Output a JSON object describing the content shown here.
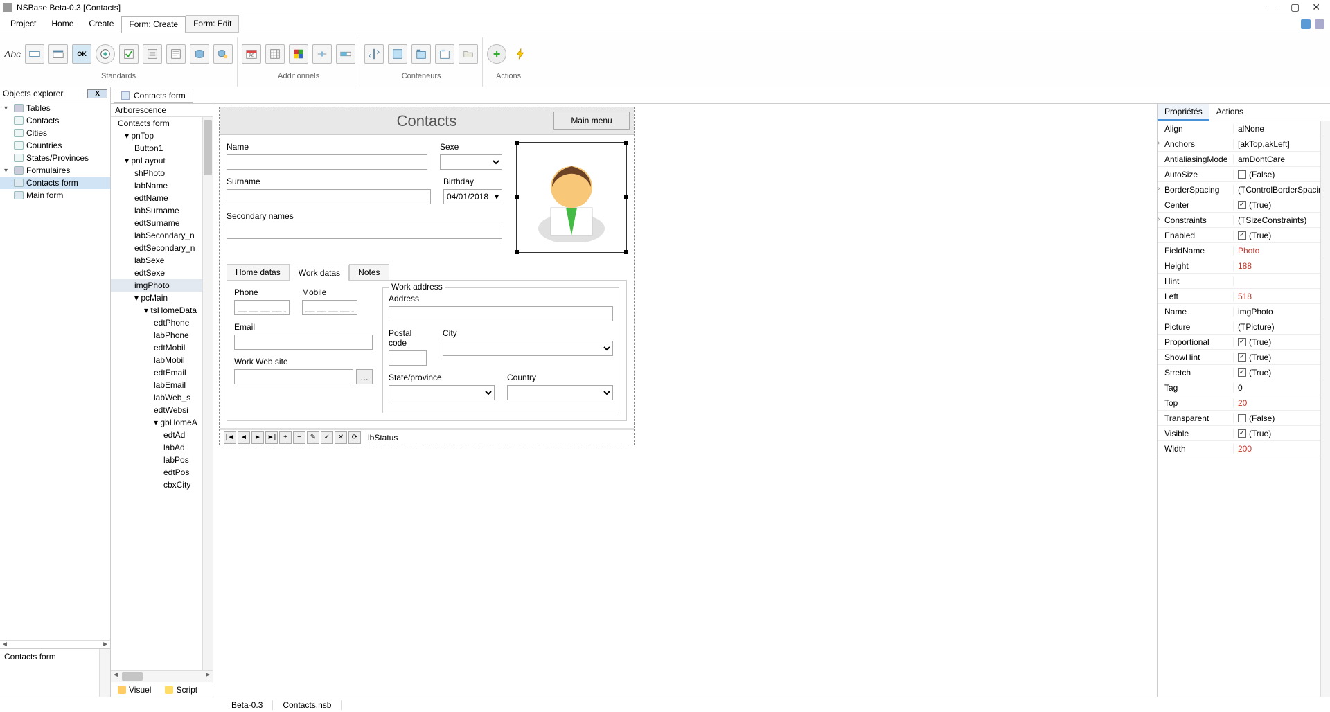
{
  "titlebar": {
    "title": "NSBase Beta-0.3 [Contacts]"
  },
  "menubar": {
    "items": [
      "Project",
      "Home",
      "Create"
    ],
    "tabs": {
      "active": "Form: Create",
      "other": "Form: Edit"
    }
  },
  "ribbon": {
    "groups": [
      {
        "label": "Standards",
        "label_tool": "Abc",
        "ok": "OK"
      },
      {
        "label": "Additionnels",
        "cal": "26"
      },
      {
        "label": "Conteneurs"
      },
      {
        "label": "Actions"
      }
    ]
  },
  "objects_explorer": {
    "title": "Objects explorer",
    "close": "X",
    "tables_label": "Tables",
    "tables": [
      "Contacts",
      "Cities",
      "Countries",
      "States/Provinces"
    ],
    "forms_label": "Formulaires",
    "forms": [
      "Contacts form",
      "Main form"
    ],
    "bottom_text": "Contacts form"
  },
  "doc_tab": "Contacts form",
  "arbo": {
    "header": "Arborescence",
    "root": "Contacts form",
    "pnTop": "pnTop",
    "button1": "Button1",
    "pnLayout": "pnLayout",
    "layout_items": [
      "shPhoto",
      "labName",
      "edtName",
      "labSurname",
      "edtSurname",
      "labSecondary_n",
      "edtSecondary_n",
      "labSexe",
      "edtSexe",
      "imgPhoto"
    ],
    "pcMain": "pcMain",
    "tsHomeData": "tsHomeData",
    "ts_items": [
      "edtPhone",
      "labPhone",
      "edtMobil",
      "labMobil",
      "edtEmail",
      "labEmail",
      "labWeb_s",
      "edtWebsi"
    ],
    "gbHome": "gbHomeA",
    "gb_items": [
      "edtAd",
      "labAd",
      "labPos",
      "edtPos",
      "cbxCity"
    ],
    "bottom_tabs": {
      "visuel": "Visuel",
      "script": "Script"
    }
  },
  "form": {
    "title": "Contacts",
    "main_menu": "Main menu",
    "labels": {
      "name": "Name",
      "sexe": "Sexe",
      "surname": "Surname",
      "birthday": "Birthday",
      "secondary": "Secondary names",
      "birthday_val": "04/01/2018"
    },
    "tabs": {
      "home": "Home datas",
      "work": "Work datas",
      "notes": "Notes"
    },
    "work": {
      "phone": "Phone",
      "mobile": "Mobile",
      "email": "Email",
      "website": "Work Web site",
      "mask": "__ __ __ __ __",
      "browse": "...",
      "address_group": "Work address",
      "address": "Address",
      "postal": "Postal code",
      "city": "City",
      "state": "State/province",
      "country": "Country"
    },
    "status": "lbStatus"
  },
  "props": {
    "tabs": {
      "p": "Propriétés",
      "a": "Actions"
    },
    "rows": [
      {
        "k": "Align",
        "v": "alNone"
      },
      {
        "k": "Anchors",
        "v": "[akTop,akLeft]",
        "exp": true
      },
      {
        "k": "AntialiasingMode",
        "v": "amDontCare"
      },
      {
        "k": "AutoSize",
        "v": "(False)",
        "check": false
      },
      {
        "k": "BorderSpacing",
        "v": "(TControlBorderSpacing",
        "exp": true
      },
      {
        "k": "Center",
        "v": "(True)",
        "check": true
      },
      {
        "k": "Constraints",
        "v": "(TSizeConstraints)",
        "exp": true
      },
      {
        "k": "Enabled",
        "v": "(True)",
        "check": true
      },
      {
        "k": "FieldName",
        "v": "Photo",
        "special": true
      },
      {
        "k": "Height",
        "v": "188",
        "num": true
      },
      {
        "k": "Hint",
        "v": ""
      },
      {
        "k": "Left",
        "v": "518",
        "num": true
      },
      {
        "k": "Name",
        "v": "imgPhoto"
      },
      {
        "k": "Picture",
        "v": "(TPicture)"
      },
      {
        "k": "Proportional",
        "v": "(True)",
        "check": true
      },
      {
        "k": "ShowHint",
        "v": "(True)",
        "check": true
      },
      {
        "k": "Stretch",
        "v": "(True)",
        "check": true
      },
      {
        "k": "Tag",
        "v": "0"
      },
      {
        "k": "Top",
        "v": "20",
        "num": true
      },
      {
        "k": "Transparent",
        "v": "(False)",
        "check": false
      },
      {
        "k": "Visible",
        "v": "(True)",
        "check": true
      },
      {
        "k": "Width",
        "v": "200",
        "num": true
      }
    ]
  },
  "statusbar": {
    "version": "Beta-0.3",
    "file": "Contacts.nsb"
  }
}
